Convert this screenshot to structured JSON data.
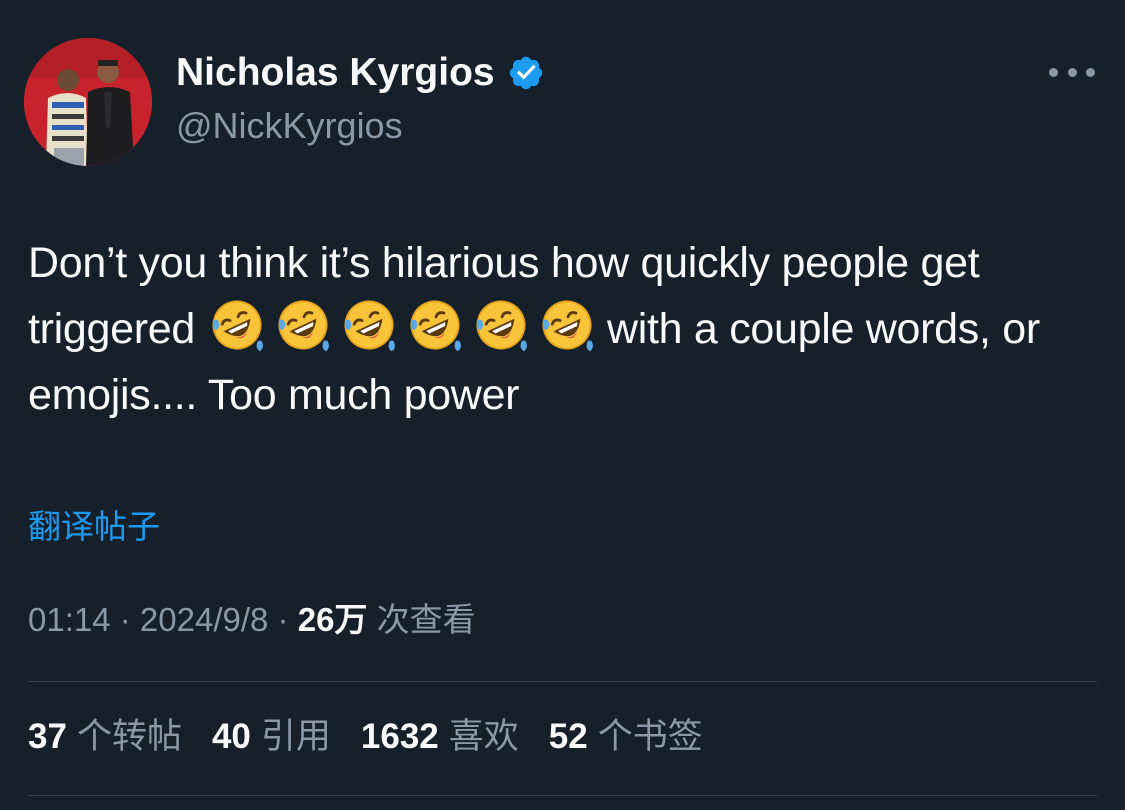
{
  "author": {
    "display_name": "Nicholas Kyrgios",
    "handle": "@NickKyrgios",
    "verified": true,
    "avatar_icon": "avatar-photo"
  },
  "tweet": {
    "text_part1": "Don’t you think it’s hilarious how quickly people get triggered",
    "emoji_count": 6,
    "emoji_name": "rolling-on-the-floor-laughing-emoji",
    "text_part2": "with a couple words, or emojis.... Too much power"
  },
  "translate_label": "翻译帖子",
  "meta": {
    "time": "01:14",
    "separator": " · ",
    "date": "2024/9/8",
    "views_count": "26万",
    "views_label": "次查看"
  },
  "stats": [
    {
      "count": "37",
      "label": "个转帖"
    },
    {
      "count": "40",
      "label": "引用"
    },
    {
      "count": "1632",
      "label": "喜欢"
    },
    {
      "count": "52",
      "label": "个书签"
    }
  ],
  "colors": {
    "background": "#15202b",
    "text": "#f7f9f9",
    "muted": "#8b98a5",
    "accent": "#1d9bf0",
    "divider": "#38444d",
    "avatar_bg": "#c8232c"
  }
}
